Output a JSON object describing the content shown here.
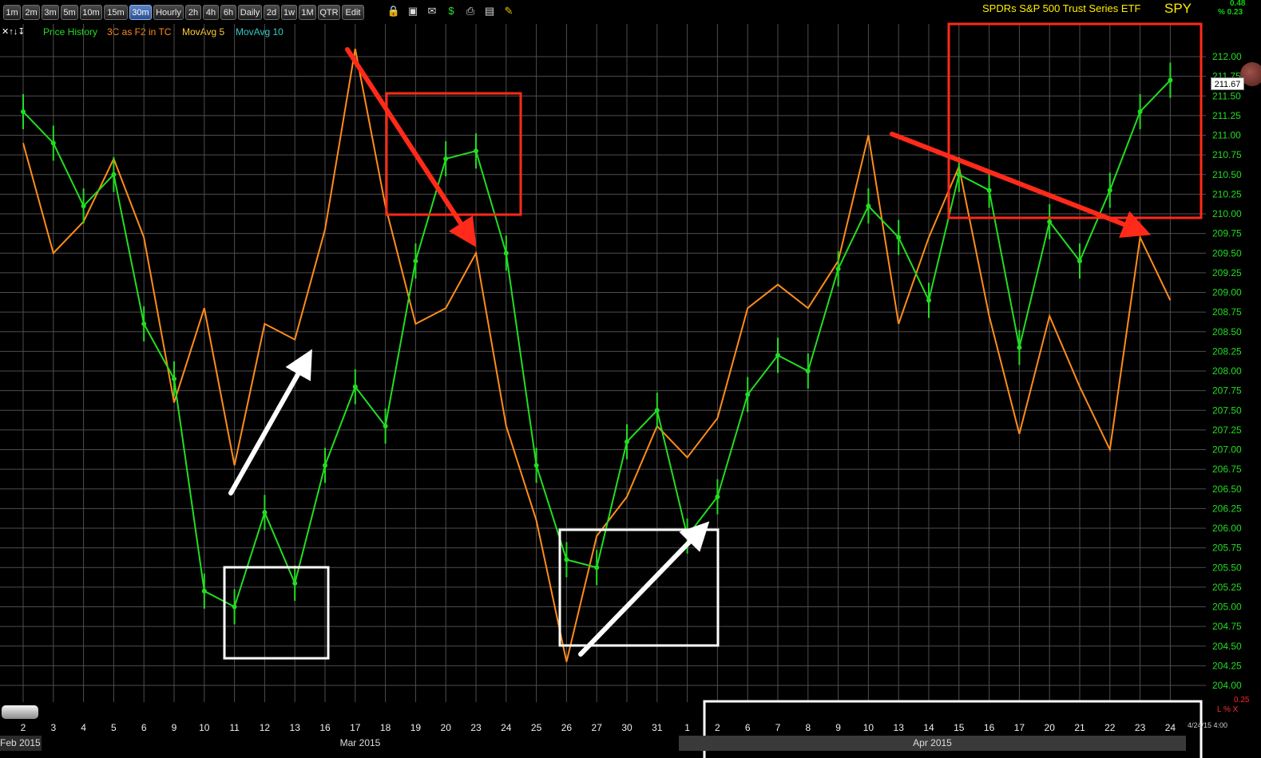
{
  "toolbar": {
    "timeframes": [
      "1m",
      "2m",
      "3m",
      "5m",
      "10m",
      "15m",
      "30m",
      "Hourly",
      "2h",
      "4h",
      "6h",
      "Daily",
      "2d",
      "1w",
      "1M",
      "QTR",
      "Edit"
    ],
    "active_timeframe": "30m",
    "icons": [
      "lock-icon",
      "save-icon",
      "mail-icon",
      "dollar-icon",
      "print-icon",
      "settings-icon",
      "pencil-icon"
    ]
  },
  "header": {
    "title": "SPDRs S&P 500 Trust Series ETF",
    "ticker": "SPY",
    "change_value": "0.48",
    "change_percent": "% 0.23"
  },
  "legend": {
    "items": [
      {
        "label": "Price History",
        "color": "#22dd22"
      },
      {
        "label": "3C as F2 in TC",
        "color": "#ff8c1a"
      },
      {
        "label": "MovAvg 5",
        "color": "#ffcc33"
      },
      {
        "label": "MovAvg 10",
        "color": "#33cccc"
      }
    ]
  },
  "price_tag": "211.67",
  "date_label": "4/24/15 4:00",
  "right_indicator_value": "0.25",
  "right_indicator_controls": "L % X",
  "months": [
    "Feb 2015",
    "Mar 2015",
    "Apr 2015"
  ],
  "colors": {
    "price": "#22dd22",
    "oscillator": "#ff8c1a",
    "grid": "#4d4d4d",
    "axis_text": "#22dd22"
  },
  "chart_data": {
    "type": "line",
    "title": "SPDRs S&P 500 Trust Series ETF",
    "x_ticks": [
      "2",
      "3",
      "4",
      "5",
      "6",
      "9",
      "10",
      "11",
      "12",
      "13",
      "16",
      "17",
      "18",
      "19",
      "20",
      "23",
      "24",
      "25",
      "26",
      "27",
      "30",
      "31",
      "1",
      "2",
      "6",
      "7",
      "8",
      "9",
      "10",
      "13",
      "14",
      "15",
      "16",
      "17",
      "20",
      "21",
      "22",
      "23",
      "24"
    ],
    "y_ticks": [
      "204.00",
      "204.25",
      "204.50",
      "204.75",
      "205.00",
      "205.25",
      "205.50",
      "205.75",
      "206.00",
      "206.25",
      "206.50",
      "206.75",
      "207.00",
      "207.25",
      "207.50",
      "207.75",
      "208.00",
      "208.25",
      "208.50",
      "208.75",
      "209.00",
      "209.25",
      "209.50",
      "209.75",
      "210.00",
      "210.25",
      "210.50",
      "210.75",
      "211.00",
      "211.25",
      "211.50",
      "211.75",
      "212.00"
    ],
    "ylim": [
      204.0,
      212.0
    ],
    "grid": true,
    "series": [
      {
        "name": "Price History",
        "x": [
          0,
          1,
          2,
          3,
          4,
          5,
          6,
          7,
          8,
          9,
          10,
          11,
          12,
          13,
          14,
          15,
          16,
          17,
          18,
          19,
          20,
          21,
          22,
          23,
          24,
          25,
          26,
          27,
          28,
          29,
          30,
          31,
          32,
          33,
          34,
          35,
          36,
          37,
          38
        ],
        "values": [
          211.3,
          210.9,
          210.1,
          210.5,
          208.6,
          207.9,
          205.2,
          205.0,
          206.2,
          205.3,
          206.8,
          207.8,
          207.3,
          209.4,
          210.7,
          210.8,
          209.5,
          206.8,
          205.6,
          205.5,
          207.1,
          207.5,
          205.9,
          206.4,
          207.7,
          208.2,
          208.0,
          209.3,
          210.1,
          209.7,
          208.9,
          210.5,
          210.3,
          208.3,
          209.9,
          209.4,
          210.3,
          211.3,
          211.7
        ]
      },
      {
        "name": "3C as F2 in TC",
        "x": [
          0,
          1,
          2,
          3,
          4,
          5,
          6,
          7,
          8,
          9,
          10,
          11,
          12,
          13,
          14,
          15,
          16,
          17,
          18,
          19,
          20,
          21,
          22,
          23,
          24,
          25,
          26,
          27,
          28,
          29,
          30,
          31,
          32,
          33,
          34,
          35,
          36,
          37,
          38
        ],
        "values": [
          210.9,
          209.5,
          209.9,
          210.7,
          209.7,
          207.6,
          208.8,
          206.8,
          208.6,
          208.4,
          209.8,
          212.1,
          210.1,
          208.6,
          208.8,
          209.5,
          207.3,
          206.1,
          204.3,
          205.9,
          206.4,
          207.3,
          206.9,
          207.4,
          208.8,
          209.1,
          208.8,
          209.4,
          211.0,
          208.6,
          209.7,
          210.6,
          208.7,
          207.2,
          208.7,
          207.8,
          207.0,
          209.7,
          208.9
        ]
      }
    ]
  }
}
